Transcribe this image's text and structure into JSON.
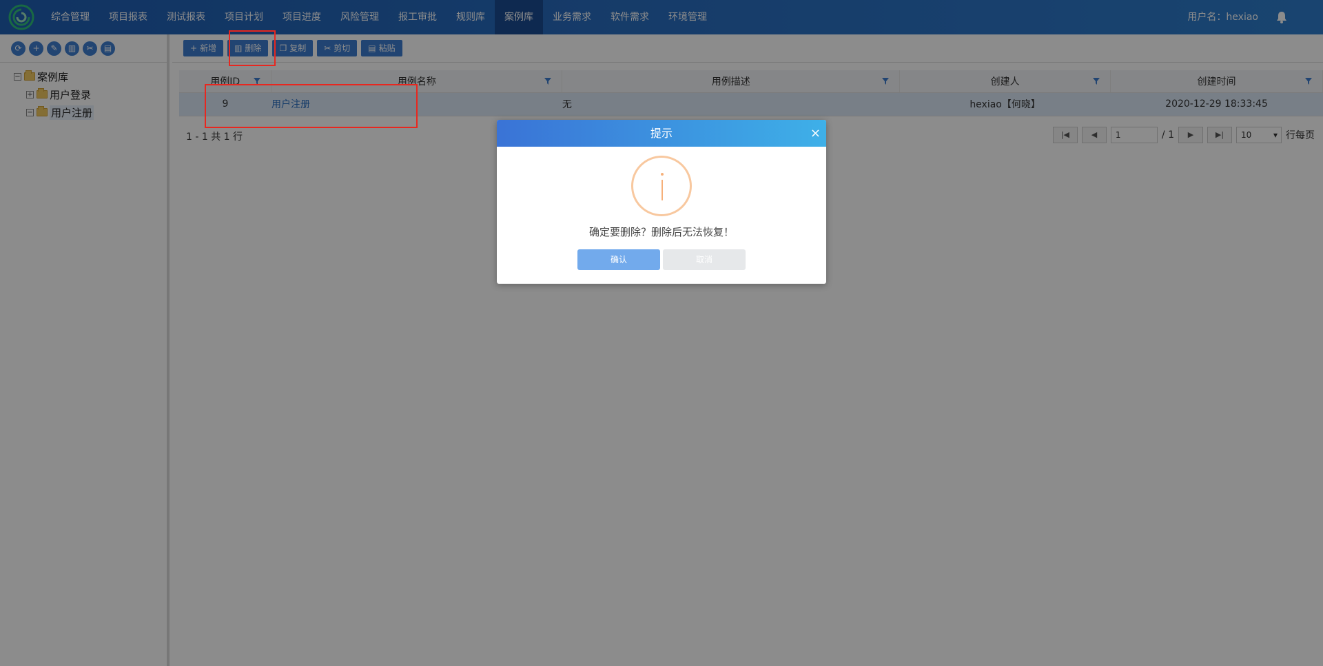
{
  "nav": {
    "items": [
      "综合管理",
      "项目报表",
      "测试报表",
      "项目计划",
      "项目进度",
      "风险管理",
      "报工审批",
      "规则库",
      "案例库",
      "业务需求",
      "软件需求",
      "环境管理"
    ],
    "active_index": 8,
    "user_label": "用户名：hexiao",
    "logo_icon": "swirl-logo",
    "bell_icon": "bell-icon"
  },
  "left": {
    "tools": [
      "refresh-icon",
      "add-icon",
      "edit-icon",
      "delete-icon",
      "cut-icon",
      "paste-icon"
    ],
    "tree": {
      "root": "案例库",
      "children": [
        "用户登录",
        "用户注册"
      ],
      "selected": "用户注册"
    }
  },
  "toolbar": {
    "new_label": "新增",
    "delete_label": "删除",
    "copy_label": "复制",
    "cut_label": "剪切",
    "paste_label": "粘贴"
  },
  "table": {
    "headers": [
      "用例ID",
      "用例名称",
      "用例描述",
      "创建人",
      "创建时间"
    ],
    "rows": [
      {
        "id": "9",
        "name": "用户注册",
        "desc": "无",
        "creator": "hexiao【何晓】",
        "time": "2020-12-29 18:33:45"
      }
    ]
  },
  "pagination": {
    "info": "1 - 1 共 1 行",
    "current_page": "1",
    "total_pages": "/ 1",
    "page_size": "10",
    "per_page_label": "行每页"
  },
  "dialog": {
    "title": "提示",
    "close": "×",
    "message": "确定要删除？删除后无法恢复！",
    "confirm_label": "确认",
    "cancel_label": "取消",
    "icon": "info-icon"
  },
  "colors": {
    "nav_bg": "#2a6fc2",
    "nav_active": "#1a4c93",
    "accent": "#3d7dcf",
    "highlight_red": "#e8271f",
    "confirm_btn": "#72aaec"
  }
}
